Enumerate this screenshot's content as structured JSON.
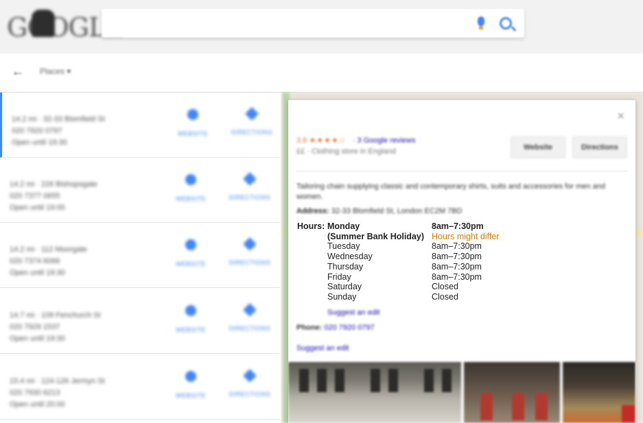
{
  "header": {
    "logo_text": "GOOGLE",
    "search_value": ""
  },
  "subnav": {
    "back_icon": "arrow-left-icon",
    "places_label": "Places ▾"
  },
  "results": [
    {
      "line1": "14.2 mi · 32-33 Blomfield St",
      "line2": "020 7920 0797",
      "line3": "Open until 19:30",
      "website_label": "WEBSITE",
      "directions_label": "DIRECTIONS"
    },
    {
      "line1": "14.2 mi · 226 Bishopsgate",
      "line2": "020 7377 0655",
      "line3": "Open until 19:00",
      "website_label": "WEBSITE",
      "directions_label": "DIRECTIONS"
    },
    {
      "line1": "14.2 mi · 112 Moorgate",
      "line2": "020 7374 6066",
      "line3": "Open until 19:30",
      "website_label": "WEBSITE",
      "directions_label": "DIRECTIONS"
    },
    {
      "line1": "14.7 mi · 109 Fenchurch St",
      "line2": "020 7929 1537",
      "line3": "Open until 19:30",
      "website_label": "WEBSITE",
      "directions_label": "DIRECTIONS"
    },
    {
      "line1": "15.4 mi · 124-126 Jermyn St",
      "line2": "020 7930 6213",
      "line3": "Open until 20:00",
      "website_label": "WEBSITE",
      "directions_label": "DIRECTIONS"
    }
  ],
  "detail": {
    "close_label": "×",
    "rating": "3.6",
    "stars": "★★★★☆",
    "reviews": "· 3 Google reviews",
    "category": "££ · Clothing store in England",
    "website_btn": "Website",
    "directions_btn": "Directions",
    "description": "Tailoring chain supplying classic and contemporary shirts, suits and accessories for men and women.",
    "address_label": "Address:",
    "address_value": "32-33 Blomfield St, London EC2M 7BD",
    "hours_label": "Hours:",
    "hours": [
      {
        "day": "Monday",
        "time": "8am–7:30pm"
      },
      {
        "day": "(Summer Bank Holiday)",
        "time": "Hours might differ"
      },
      {
        "day": "Tuesday",
        "time": "8am–7:30pm"
      },
      {
        "day": "Wednesday",
        "time": "8am–7:30pm"
      },
      {
        "day": "Thursday",
        "time": "8am–7:30pm"
      },
      {
        "day": "Friday",
        "time": "8am–7:30pm"
      },
      {
        "day": "Saturday",
        "time": "Closed"
      },
      {
        "day": "Sunday",
        "time": "Closed"
      }
    ],
    "suggest_edit_hours": "Suggest an edit",
    "phone_label": "Phone:",
    "phone_value": "020 7920 0797",
    "suggest_edit": "Suggest an edit"
  },
  "colors": {
    "accent": "#4285f4",
    "link": "#1a0dab",
    "rating": "#e7711b",
    "warning": "#e67c00"
  }
}
